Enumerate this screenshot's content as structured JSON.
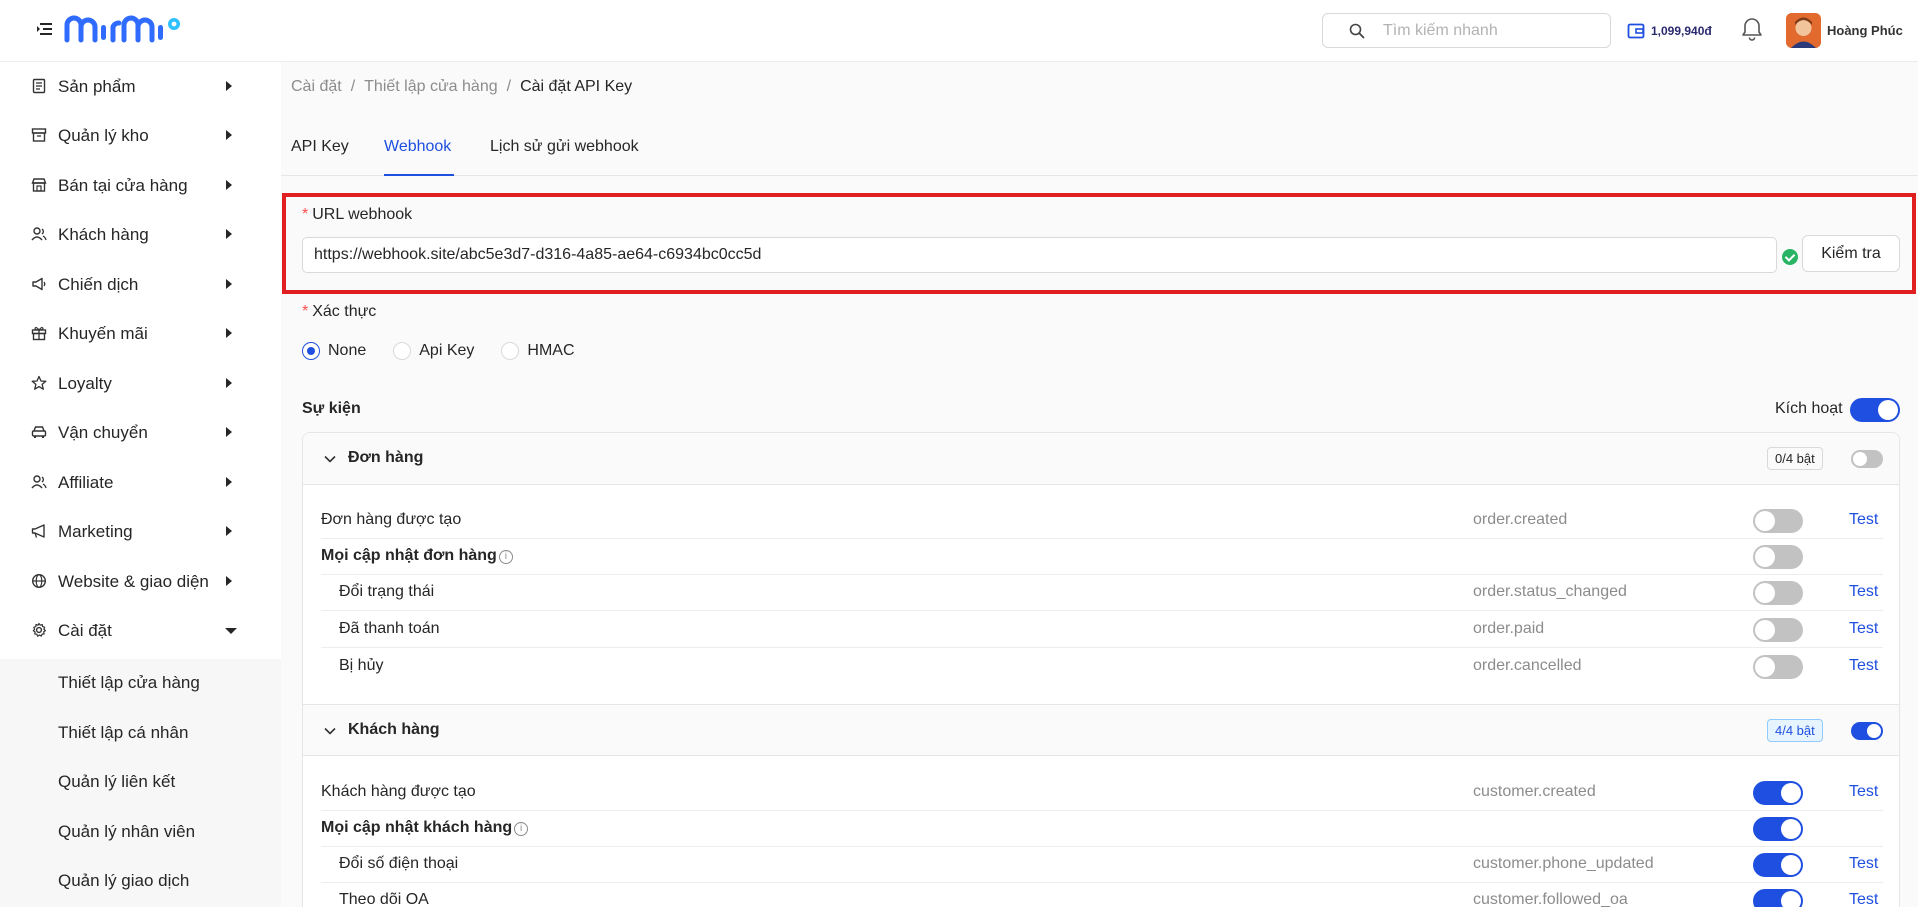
{
  "header": {
    "search_placeholder": "Tìm kiếm nhanh",
    "wallet_balance": "1,099,940đ",
    "user_name": "Hoàng Phúc"
  },
  "sidebar": {
    "items": [
      {
        "label": "Sản phẩm",
        "icon": "product-icon"
      },
      {
        "label": "Quản lý kho",
        "icon": "warehouse-icon"
      },
      {
        "label": "Bán tại cửa hàng",
        "icon": "store-icon"
      },
      {
        "label": "Khách hàng",
        "icon": "customers-icon"
      },
      {
        "label": "Chiến dịch",
        "icon": "campaign-icon"
      },
      {
        "label": "Khuyến mãi",
        "icon": "gift-icon"
      },
      {
        "label": "Loyalty",
        "icon": "star-icon"
      },
      {
        "label": "Vận chuyển",
        "icon": "car-icon"
      },
      {
        "label": "Affiliate",
        "icon": "affiliate-icon"
      },
      {
        "label": "Marketing",
        "icon": "megaphone-icon"
      },
      {
        "label": "Website & giao diện",
        "icon": "globe-icon"
      },
      {
        "label": "Cài đặt",
        "icon": "gear-icon"
      }
    ],
    "sub_items": [
      "Thiết lập cửa hàng",
      "Thiết lập cá nhân",
      "Quản lý liên kết",
      "Quản lý nhân viên",
      "Quản lý giao dịch"
    ]
  },
  "breadcrumb": {
    "items": [
      "Cài đặt",
      "Thiết lập cửa hàng",
      "Cài đặt API Key"
    ]
  },
  "tabs": [
    {
      "label": "API Key",
      "active": false
    },
    {
      "label": "Webhook",
      "active": true
    },
    {
      "label": "Lịch sử gửi webhook",
      "active": false
    }
  ],
  "form": {
    "url_label": "URL webhook",
    "url_value": "https://webhook.site/abc5e3d7-d316-4a85-ae64-c6934bc0cc5d",
    "check_button": "Kiểm tra",
    "auth_label": "Xác thực",
    "auth_options": [
      "None",
      "Api Key",
      "HMAC"
    ],
    "auth_selected": "None"
  },
  "events": {
    "title": "Sự kiện",
    "activate_label": "Kích hoạt",
    "test_label": "Test",
    "groups": [
      {
        "title": "Đơn hàng",
        "badge": "0/4 bật",
        "rows": [
          {
            "name": "Đơn hàng được tạo",
            "code": "order.created",
            "on": false
          },
          {
            "name": "Mọi cập nhật đơn hàng",
            "code": "",
            "on": false
          },
          {
            "name": "Đổi trạng thái",
            "code": "order.status_changed",
            "on": false
          },
          {
            "name": "Đã thanh toán",
            "code": "order.paid",
            "on": false
          },
          {
            "name": "Bị hủy",
            "code": "order.cancelled",
            "on": false
          }
        ]
      },
      {
        "title": "Khách hàng",
        "badge": "4/4 bật",
        "rows": [
          {
            "name": "Khách hàng được tạo",
            "code": "customer.created",
            "on": true
          },
          {
            "name": "Mọi cập nhật khách hàng",
            "code": "",
            "on": true
          },
          {
            "name": "Đổi số điện thoại",
            "code": "customer.phone_updated",
            "on": true
          },
          {
            "name": "Theo dõi OA",
            "code": "customer.followed_oa",
            "on": true
          }
        ]
      }
    ]
  },
  "colors": {
    "primary": "#1f4fe0",
    "highlight": "#e02020",
    "success": "#28b463"
  }
}
